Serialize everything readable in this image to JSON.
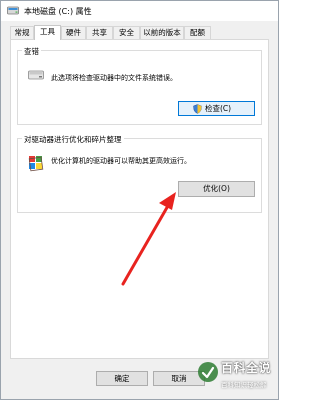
{
  "window": {
    "title": "本地磁盘 (C:) 属性"
  },
  "tabs": [
    {
      "label": "常规",
      "active": false
    },
    {
      "label": "工具",
      "active": true
    },
    {
      "label": "硬件",
      "active": false
    },
    {
      "label": "共享",
      "active": false
    },
    {
      "label": "安全",
      "active": false
    },
    {
      "label": "以前的版本",
      "active": false
    },
    {
      "label": "配额",
      "active": false
    }
  ],
  "error_check": {
    "title": "查错",
    "description": "此选项将检查驱动器中的文件系统错误。",
    "button_label": "检查(C)"
  },
  "optimize": {
    "title": "对驱动器进行优化和碎片整理",
    "description": "优化计算机的驱动器可以帮助其更高效运行。",
    "button_label": "优化(O)"
  },
  "footer": {
    "ok_label": "确定",
    "cancel_label": "取消"
  },
  "watermark": {
    "main": "百科全说",
    "sub": "百科知识轻松解"
  },
  "colors": {
    "arrow": "#e8231f",
    "accent": "#0078d7"
  }
}
